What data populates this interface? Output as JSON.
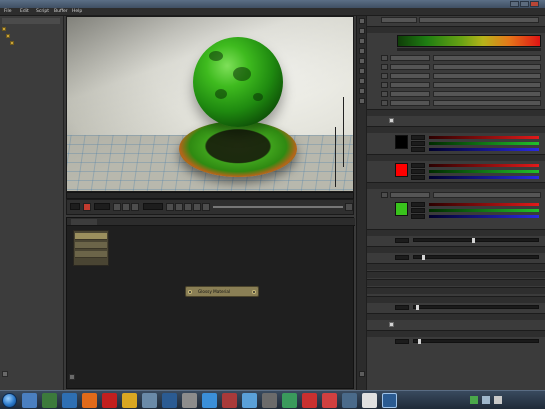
{
  "window": {
    "title": "",
    "caption": "",
    "controls": [
      "minimize",
      "maximize",
      "close"
    ]
  },
  "menu": {
    "items": [
      "File",
      "Edit",
      "Script",
      "Buffer",
      "Help"
    ]
  },
  "scene_tree": {
    "header": "",
    "items": [
      {
        "label": "",
        "selected": false,
        "indent": 0
      },
      {
        "label": "",
        "selected": false,
        "indent": 1
      },
      {
        "label": "",
        "selected": true,
        "indent": 2
      }
    ]
  },
  "viewport": {
    "status_left": "",
    "status_right": ""
  },
  "timeline": {
    "fields": [
      "",
      "",
      ""
    ]
  },
  "node_editor": {
    "tab_label": "",
    "node_label": "Glossy Material",
    "list_rows": [
      "",
      "",
      ""
    ]
  },
  "inspector": {
    "header": "",
    "colors": {
      "gradient_start": "#1e7d12",
      "gradient_mid": "#b6b31a",
      "gradient_end": "#e01414",
      "diffuse": "#000000",
      "specular": "#ff0000",
      "roughness": "#39c31c"
    },
    "sections": [
      "",
      "",
      "",
      "",
      "",
      "",
      "",
      "",
      "",
      "",
      "",
      "",
      "",
      ""
    ]
  },
  "taskbar": {
    "apps": [
      "explorer-icon",
      "media-icon",
      "firefox-icon",
      "chrome-icon",
      "yandex-icon",
      "folder-icon",
      "office-icon",
      "tool-icon",
      "app-icon",
      "app-icon",
      "app-icon",
      "app-icon",
      "app-icon",
      "app-icon",
      "app-icon",
      "app-icon",
      "app-icon",
      "app-icon",
      "app-icon",
      "app-icon"
    ],
    "tray_text": "",
    "clock_time": "",
    "clock_date": ""
  }
}
